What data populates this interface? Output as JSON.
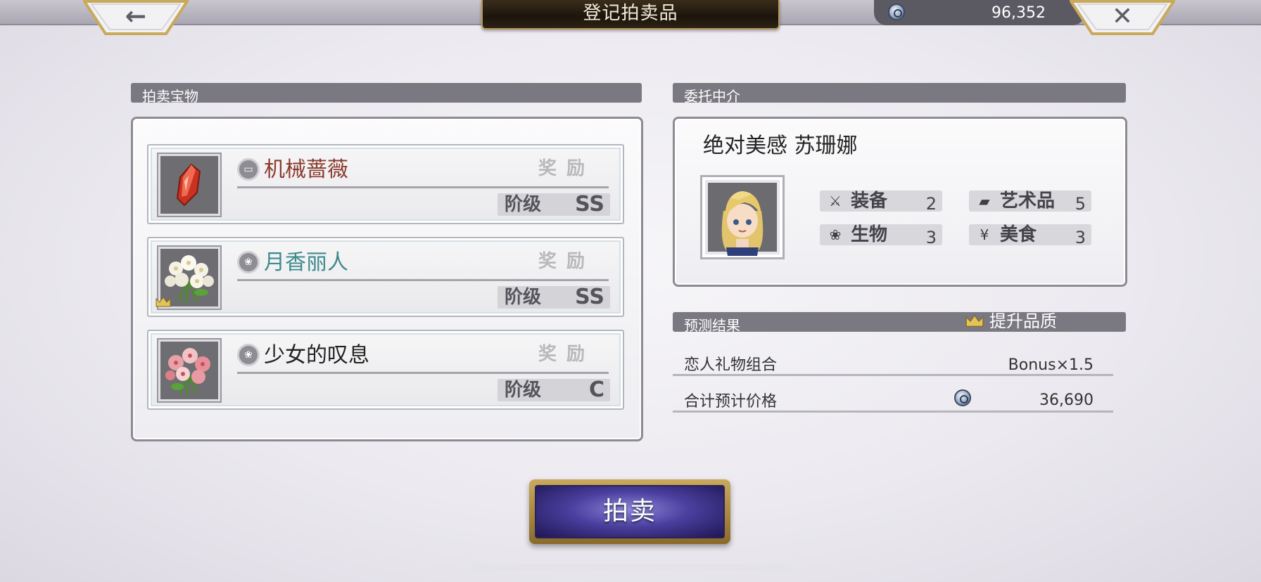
{
  "header": {
    "title": "登记拍卖品",
    "back_icon": "←",
    "close_icon": "✕",
    "currency_icon": "coin-icon",
    "currency_amount": "96,352"
  },
  "treasure": {
    "section_label": "拍卖宝物",
    "items": [
      {
        "name": "机械蔷薇",
        "name_color": "#8b3a2c",
        "reward_label": "奖励",
        "grade_label": "阶级",
        "grade": "SS",
        "thumb": "red-crystal",
        "crowned": false
      },
      {
        "name": "月香丽人",
        "name_color": "#3e8a8e",
        "reward_label": "奖励",
        "grade_label": "阶级",
        "grade": "SS",
        "thumb": "white-flowers",
        "crowned": true
      },
      {
        "name": "少女的叹息",
        "name_color": "#222222",
        "reward_label": "奖励",
        "grade_label": "阶级",
        "grade": "C",
        "thumb": "pink-flowers",
        "crowned": false
      }
    ]
  },
  "agent": {
    "section_label": "委托中介",
    "name": "绝对美感 苏珊娜",
    "stats": [
      {
        "label": "装备",
        "value": "2",
        "icon": "equipment-icon"
      },
      {
        "label": "艺术品",
        "value": "5",
        "icon": "art-icon"
      },
      {
        "label": "生物",
        "value": "3",
        "icon": "creature-icon"
      },
      {
        "label": "美食",
        "value": "3",
        "icon": "food-icon"
      }
    ]
  },
  "result": {
    "section_label": "预测结果",
    "quality_label": "提升品质",
    "rows": [
      {
        "label": "恋人礼物组合",
        "value": "Bonus×1.5"
      },
      {
        "label": "合计预计价格",
        "value": "36,690"
      }
    ]
  },
  "actions": {
    "auction_label": "拍卖"
  },
  "colors": {
    "section_header": "#7a7880",
    "button_purple": "#4a3f9e",
    "gold_trim": "#c9a95c"
  }
}
